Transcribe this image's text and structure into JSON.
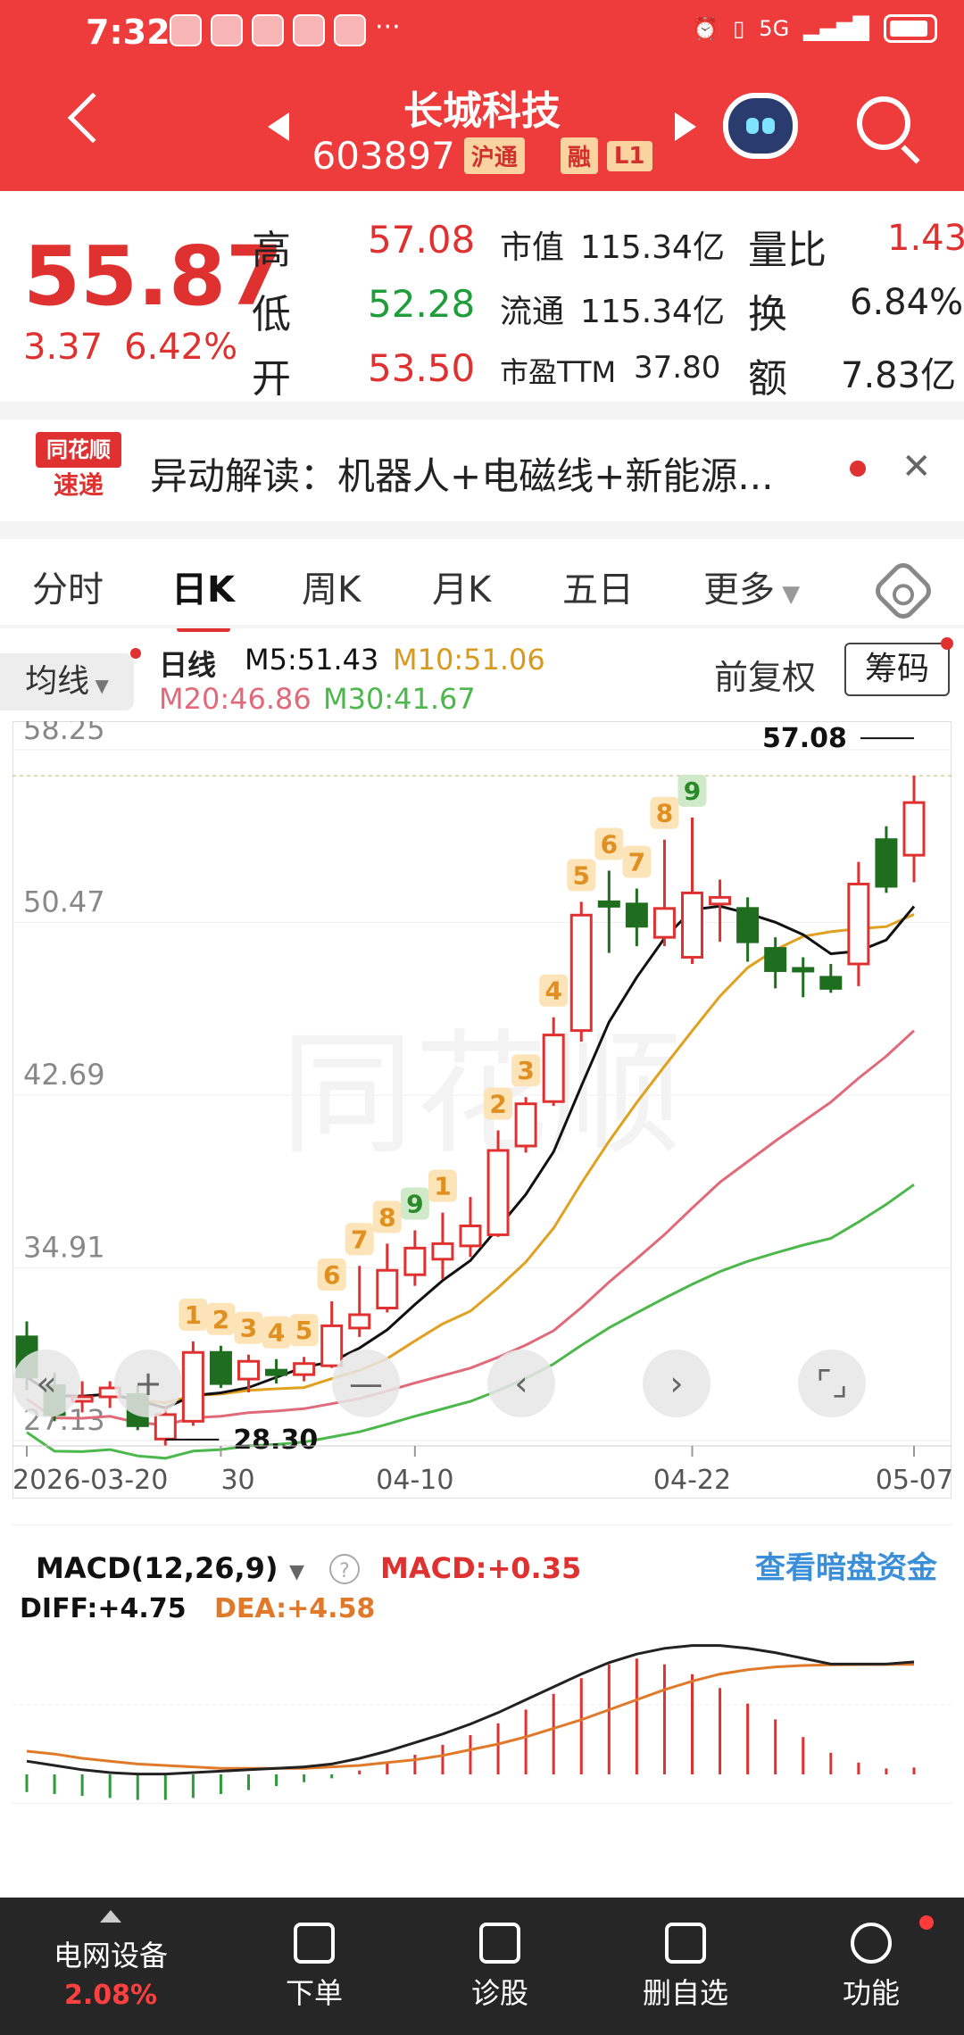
{
  "status": {
    "time": "7:32",
    "network": "5G"
  },
  "header": {
    "title": "长城科技",
    "code": "603897",
    "tags": [
      "沪通",
      "融",
      "L1"
    ]
  },
  "quote": {
    "price": "55.87",
    "change": "3.37",
    "change_pct": "6.42%",
    "cells": [
      {
        "label": "高",
        "value": "57.08",
        "color": "red"
      },
      {
        "label": "低",
        "value": "52.28",
        "color": "green"
      },
      {
        "label": "开",
        "value": "53.50",
        "color": "red"
      }
    ],
    "mid": [
      {
        "label": "市值",
        "value": "115.34亿"
      },
      {
        "label": "流通",
        "value": "115.34亿"
      },
      {
        "label": "市盈TTM",
        "value": "37.80"
      }
    ],
    "right": [
      {
        "label": "量比",
        "value": "1.43",
        "color": "red"
      },
      {
        "label": "换",
        "value": "6.84%",
        "color": "dark"
      },
      {
        "label": "额",
        "value": "7.83亿",
        "color": "dark"
      }
    ]
  },
  "news": {
    "logo_top": "同花顺",
    "logo_bottom": "速递",
    "text": "异动解读：机器人+电磁线+新能源..."
  },
  "tabs": [
    "分时",
    "日K",
    "周K",
    "月K",
    "五日",
    "更多"
  ],
  "legend": {
    "avg_button": "均线",
    "day_label": "日线",
    "m5": "M5:51.43",
    "m10": "M10:51.06",
    "m20": "M20:46.86",
    "m30": "M30:41.67",
    "adjust": "前复权",
    "chips": "筹码"
  },
  "chart_data": {
    "type": "candlestick",
    "y_ticks": [
      "58.25",
      "50.47",
      "42.69",
      "34.91",
      "27.13"
    ],
    "x_ticks": [
      "2026-03-20",
      "30",
      "04-10",
      "04-22",
      "05-07"
    ],
    "high_label": "57.08",
    "low_label": "28.30",
    "ylim": [
      27.13,
      58.25
    ],
    "candles": [
      {
        "o": 31.8,
        "h": 32.5,
        "l": 29.4,
        "c": 30.0
      },
      {
        "o": 29.6,
        "h": 30.2,
        "l": 28.0,
        "c": 28.3
      },
      {
        "o": 28.9,
        "h": 29.8,
        "l": 28.4,
        "c": 29.1
      },
      {
        "o": 29.1,
        "h": 29.8,
        "l": 28.6,
        "c": 29.5
      },
      {
        "o": 29.2,
        "h": 29.6,
        "l": 27.6,
        "c": 27.8
      },
      {
        "o": 27.2,
        "h": 28.6,
        "l": 26.9,
        "c": 28.3
      },
      {
        "o": 28.0,
        "h": 31.6,
        "l": 27.8,
        "c": 31.1
      },
      {
        "o": 31.1,
        "h": 31.4,
        "l": 29.5,
        "c": 29.7
      },
      {
        "o": 29.9,
        "h": 31.0,
        "l": 29.3,
        "c": 30.7
      },
      {
        "o": 30.3,
        "h": 30.8,
        "l": 29.7,
        "c": 30.1
      },
      {
        "o": 30.1,
        "h": 30.9,
        "l": 29.8,
        "c": 30.6
      },
      {
        "o": 30.5,
        "h": 33.4,
        "l": 30.4,
        "c": 32.3
      },
      {
        "o": 32.2,
        "h": 35.0,
        "l": 31.8,
        "c": 32.8
      },
      {
        "o": 33.1,
        "h": 36.0,
        "l": 32.9,
        "c": 34.8
      },
      {
        "o": 34.6,
        "h": 36.6,
        "l": 34.1,
        "c": 35.8
      },
      {
        "o": 35.3,
        "h": 37.4,
        "l": 34.4,
        "c": 36.0
      },
      {
        "o": 35.9,
        "h": 38.1,
        "l": 35.4,
        "c": 36.8
      },
      {
        "o": 36.4,
        "h": 41.1,
        "l": 36.3,
        "c": 40.2
      },
      {
        "o": 40.4,
        "h": 42.6,
        "l": 40.1,
        "c": 42.3
      },
      {
        "o": 42.4,
        "h": 46.2,
        "l": 42.2,
        "c": 45.4
      },
      {
        "o": 45.6,
        "h": 51.4,
        "l": 45.1,
        "c": 50.8
      },
      {
        "o": 51.4,
        "h": 52.8,
        "l": 49.1,
        "c": 51.2
      },
      {
        "o": 51.3,
        "h": 52.0,
        "l": 49.4,
        "c": 50.3
      },
      {
        "o": 49.8,
        "h": 54.2,
        "l": 49.4,
        "c": 51.1
      },
      {
        "o": 48.9,
        "h": 55.2,
        "l": 48.6,
        "c": 51.8
      },
      {
        "o": 51.3,
        "h": 52.4,
        "l": 49.6,
        "c": 51.6
      },
      {
        "o": 51.1,
        "h": 51.6,
        "l": 48.7,
        "c": 49.6
      },
      {
        "o": 49.3,
        "h": 49.8,
        "l": 47.5,
        "c": 48.3
      },
      {
        "o": 48.4,
        "h": 48.9,
        "l": 47.1,
        "c": 48.3
      },
      {
        "o": 48.0,
        "h": 48.6,
        "l": 47.3,
        "c": 47.5
      },
      {
        "o": 48.6,
        "h": 53.2,
        "l": 47.6,
        "c": 52.2
      },
      {
        "o": 54.2,
        "h": 54.8,
        "l": 51.8,
        "c": 52.1
      },
      {
        "o": 53.5,
        "h": 57.08,
        "l": 52.28,
        "c": 55.87
      }
    ],
    "td_marks": [
      {
        "i": 6,
        "t": "1"
      },
      {
        "i": 7,
        "t": "2"
      },
      {
        "i": 8,
        "t": "3"
      },
      {
        "i": 9,
        "t": "4"
      },
      {
        "i": 10,
        "t": "5"
      },
      {
        "i": 11,
        "t": "6"
      },
      {
        "i": 12,
        "t": "7"
      },
      {
        "i": 13,
        "t": "8"
      },
      {
        "i": 14,
        "t": "9",
        "g": true
      },
      {
        "i": 15,
        "t": "1"
      },
      {
        "i": 17,
        "t": "2"
      },
      {
        "i": 18,
        "t": "3"
      },
      {
        "i": 19,
        "t": "4"
      },
      {
        "i": 20,
        "t": "5"
      },
      {
        "i": 21,
        "t": "6"
      },
      {
        "i": 22,
        "t": "7"
      },
      {
        "i": 23,
        "t": "8"
      },
      {
        "i": 24,
        "t": "9",
        "g": true
      }
    ],
    "ma_colors": {
      "m5": "#111111",
      "m10": "#e0a020",
      "m20": "#e06a7a",
      "m30": "#4cb84c"
    },
    "up_color": "#e03131",
    "down_color": "#1f6e1f"
  },
  "macd": {
    "title": "MACD(12,26,9)",
    "macd_value": "MACD:+0.35",
    "diff": "DIFF:+4.75",
    "dea": "DEA:+4.58",
    "link": "查看暗盘资金",
    "bars": [
      -0.9,
      -1.0,
      -1.1,
      -1.2,
      -1.3,
      -1.3,
      -1.2,
      -1.0,
      -0.8,
      -0.6,
      -0.4,
      -0.2,
      0.2,
      0.6,
      1.0,
      1.5,
      2.0,
      2.6,
      3.3,
      4.1,
      4.9,
      5.6,
      5.9,
      5.6,
      5.1,
      4.4,
      3.6,
      2.8,
      1.9,
      1.1,
      0.6,
      0.3,
      0.35
    ],
    "diff_line": [
      -2.2,
      -2.5,
      -2.8,
      -3.0,
      -3.1,
      -3.1,
      -3.0,
      -2.9,
      -2.8,
      -2.7,
      -2.6,
      -2.4,
      -2.0,
      -1.5,
      -0.9,
      -0.3,
      0.4,
      1.2,
      2.1,
      3.0,
      3.9,
      4.7,
      5.3,
      5.7,
      5.9,
      5.9,
      5.7,
      5.4,
      5.0,
      4.6,
      4.6,
      4.6,
      4.75
    ],
    "dea_line": [
      -1.5,
      -1.7,
      -2.0,
      -2.2,
      -2.4,
      -2.5,
      -2.6,
      -2.7,
      -2.7,
      -2.7,
      -2.7,
      -2.6,
      -2.5,
      -2.3,
      -2.1,
      -1.8,
      -1.4,
      -1.0,
      -0.5,
      0.1,
      0.7,
      1.4,
      2.1,
      2.8,
      3.4,
      3.9,
      4.2,
      4.4,
      4.5,
      4.55,
      4.56,
      4.57,
      4.58
    ]
  },
  "bottom_nav": {
    "watch_name": "电网设备",
    "watch_pct": "2.08%",
    "items": [
      "下单",
      "诊股",
      "删自选",
      "功能"
    ]
  }
}
